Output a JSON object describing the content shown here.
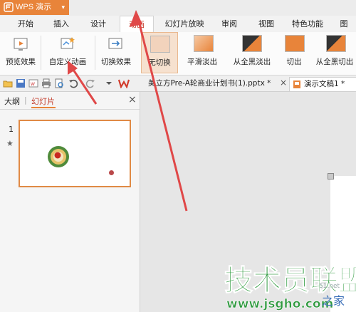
{
  "app": {
    "name": "WPS 演示",
    "caret": "▾"
  },
  "tabs": [
    {
      "label": "开始"
    },
    {
      "label": "插入"
    },
    {
      "label": "设计"
    },
    {
      "label": "动画"
    },
    {
      "label": "幻灯片放映"
    },
    {
      "label": "审阅"
    },
    {
      "label": "视图"
    },
    {
      "label": "特色功能"
    },
    {
      "label": "图"
    }
  ],
  "ribbon": {
    "preview": "预览效果",
    "custom_animation": "自定义动画",
    "switch_effect": "切换效果",
    "no_switch": "无切换",
    "smooth_fade": "平滑淡出",
    "fade_from_black": "从全黑淡出",
    "cut": "切出",
    "cut_from_black": "从全黑切出"
  },
  "docbar": {
    "doc1": "美立方Pre-A轮商业计划书(1).pptx *",
    "doc2": "演示文稿1 *",
    "close": "×"
  },
  "panel": {
    "tab_outline": "大纲",
    "tab_slides": "幻灯片",
    "separator": "|",
    "close": "×",
    "slide_number": "1",
    "star": "★"
  },
  "watermark": {
    "brand": "技术员联盟",
    "url": "www.jsgho.com",
    "side1": "51.net",
    "side2": "之家"
  },
  "colors": {
    "accent": "#e8843a",
    "active_tab_text": "#c33c2a",
    "arrow": "#e04848",
    "watermark": "#2f9a3f"
  }
}
